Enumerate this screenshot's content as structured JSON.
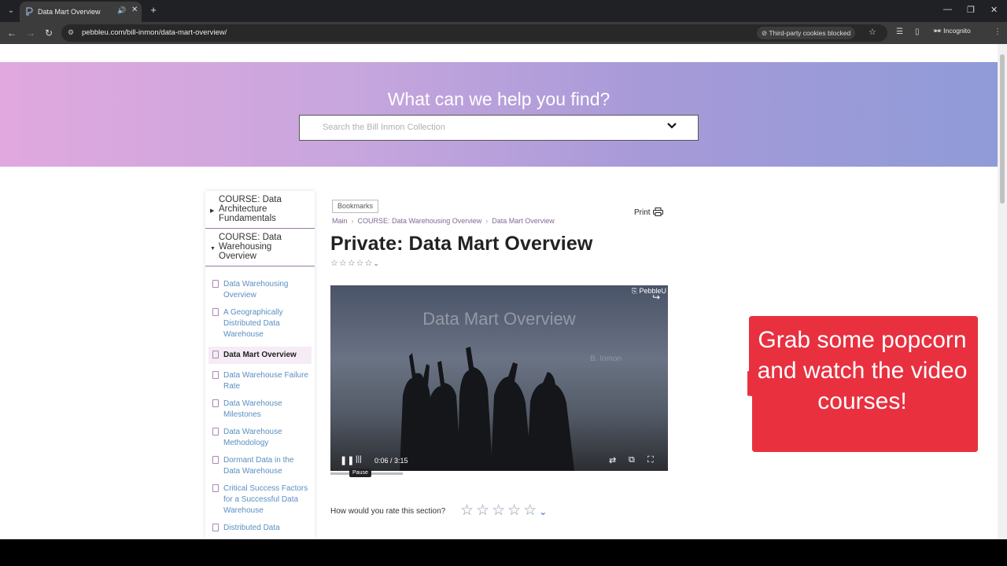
{
  "browser": {
    "tab_title": "Data Mart Overview",
    "url": "pebbleu.com/bill-inmon/data-mart-overview/",
    "cookies_label": "Third-party cookies blocked",
    "incognito_label": "Incognito"
  },
  "hero": {
    "title": "What can we help you find?",
    "search_placeholder": "Search the Bill Inmon Collection"
  },
  "sidebar": {
    "courses": [
      {
        "title": "COURSE: Data Architecture Fundamentals",
        "expanded": false
      },
      {
        "title": "COURSE: Data Warehousing Overview",
        "expanded": true
      }
    ],
    "lessons": [
      {
        "label": "Data Warehousing Overview"
      },
      {
        "label": "A Geographically Distributed Data Warehouse"
      },
      {
        "label": "Data Mart Overview",
        "active": true
      },
      {
        "label": "Data Warehouse Failure Rate"
      },
      {
        "label": "Data Warehouse Milestones"
      },
      {
        "label": "Data Warehouse Methodology"
      },
      {
        "label": "Dormant Data in the Data Warehouse"
      },
      {
        "label": "Critical Success Factors for a Successful Data Warehouse"
      },
      {
        "label": "Distributed Data"
      }
    ]
  },
  "main": {
    "bookmarks_label": "Bookmarks",
    "breadcrumb": [
      "Main",
      "COURSE: Data Warehousing Overview",
      "Data Mart Overview"
    ],
    "print_label": "Print",
    "title": "Private: Data Mart Overview",
    "video": {
      "overlay_title": "Data Mart Overview",
      "brand": "PebbleU",
      "subtitle": "B. Inmon",
      "time": "0:06 / 3:15",
      "tooltip": "Pause"
    },
    "rating_question": "How would you rate this section?"
  },
  "callout": {
    "text": "Grab some popcorn and watch the video courses!",
    "color": "#e8303f"
  }
}
